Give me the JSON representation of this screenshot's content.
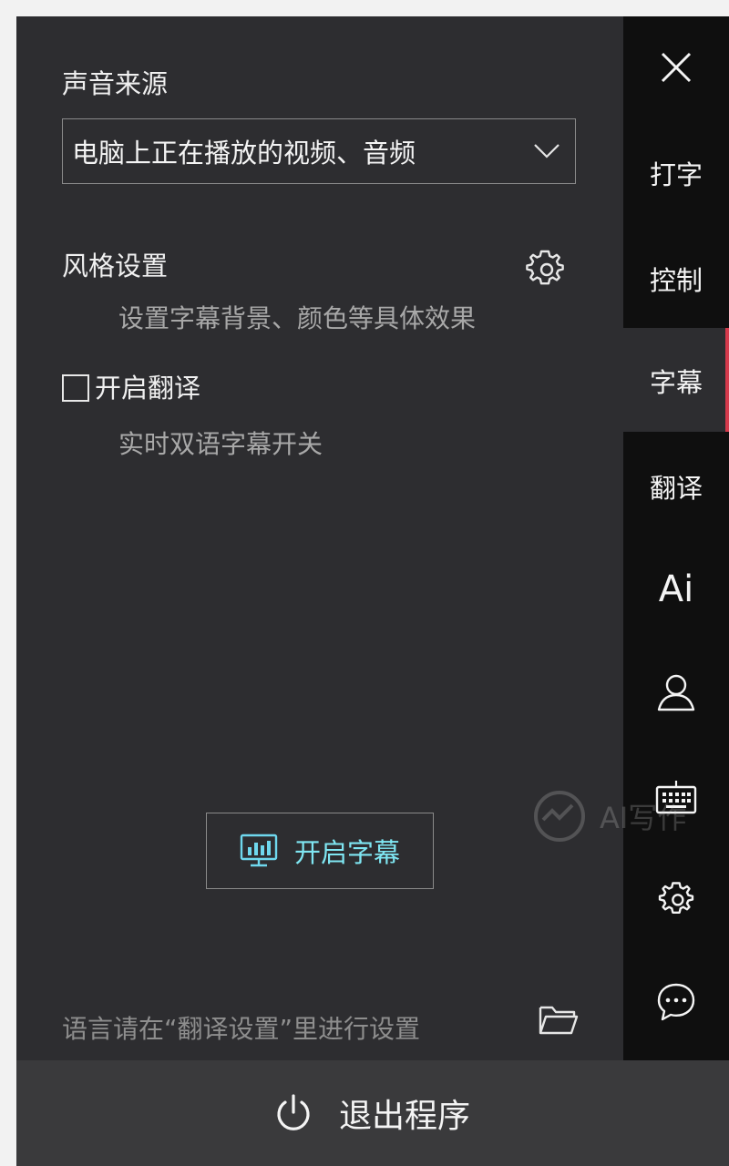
{
  "sound_source": {
    "title": "声音来源",
    "selected": "电脑上正在播放的视频、音频"
  },
  "style": {
    "title": "风格设置",
    "description": "设置字幕背景、颜色等具体效果"
  },
  "translation": {
    "label": "开启翻译",
    "description": "实时双语字幕开关",
    "checked": false
  },
  "start_button": {
    "label": "开启字幕"
  },
  "hint": "语言请在“翻译设置”里进行设置",
  "sidebar": {
    "items": [
      {
        "label": "打字"
      },
      {
        "label": "控制"
      },
      {
        "label": "字幕",
        "active": true
      },
      {
        "label": "翻译"
      },
      {
        "label": "Ai"
      }
    ],
    "icons": [
      "close-icon",
      "user-icon",
      "keyboard-icon",
      "gear-icon",
      "chat-icon"
    ]
  },
  "exit_button": {
    "label": "退出程序"
  },
  "watermark": {
    "text": "AI写作"
  },
  "colors": {
    "panel_bg": "#2d2d30",
    "sidebar_bg": "#0f0f0f",
    "accent_active": "#d63a4c",
    "start_text": "#7fe6f2"
  }
}
